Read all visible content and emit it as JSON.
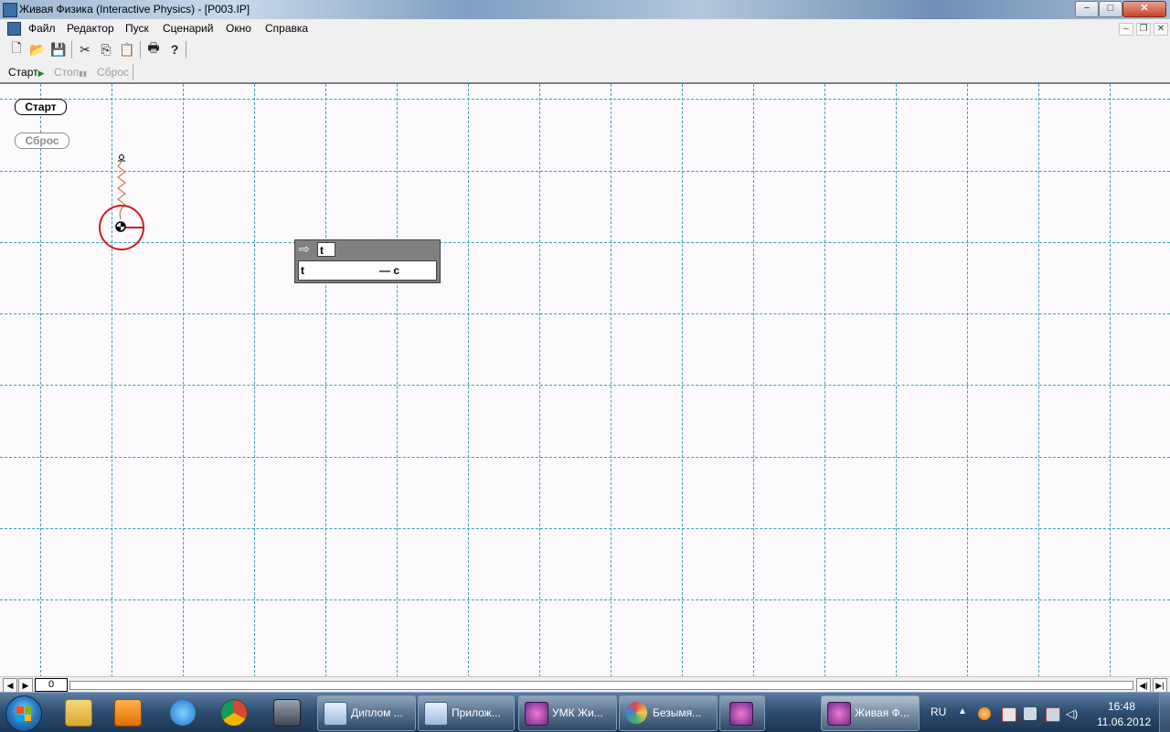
{
  "window": {
    "title": "Живая Физика (Interactive Physics) - [P003.IP]",
    "minimize_glyph": "−",
    "maximize_glyph": "□",
    "close_glyph": "✕"
  },
  "menu": {
    "items": [
      "Файл",
      "Редактор",
      "Пуск",
      "Сценарий",
      "Окно",
      "Справка"
    ],
    "mdi_minimize": "–",
    "mdi_restore": "❐",
    "mdi_close": "✕"
  },
  "toolbar": {
    "buttons": [
      "new-file-icon",
      "open-folder-icon",
      "save-icon",
      "cut-icon",
      "copy-icon",
      "paste-icon",
      "print-icon",
      "help-icon"
    ],
    "glyphs": {
      "new": "🗋",
      "open": "📂",
      "save": "💾",
      "cut": "✂",
      "copy": "⎘",
      "paste": "📋",
      "print": "🖶",
      "help": "?"
    }
  },
  "runbar": {
    "start": "Старт",
    "start_glyph": "▶",
    "stop": "Стоп",
    "stop_glyph": "▮▮",
    "reset": "Сброс"
  },
  "workspace": {
    "start_button": "Старт",
    "reset_button": "Сброс",
    "meter": {
      "title": "t",
      "arrow": "⇨",
      "row_label": "t",
      "row_value": "— c"
    },
    "colors": {
      "grid": "#3b9fb7",
      "circle": "#d11a1a",
      "spring": "#c0632a"
    }
  },
  "frame_bar": {
    "left_arrow": "◀",
    "right_arrow": "▶",
    "frame": "0",
    "end_left": "◀|",
    "end_right": "▶|"
  },
  "taskbar": {
    "tasks": [
      "Диплом ...",
      "Прилож...",
      "УМК Жи...",
      "Безымя...",
      "",
      "Живая Ф..."
    ],
    "lang": "RU",
    "tray_up": "▲",
    "time": "16:48",
    "date": "11.06.2012"
  }
}
